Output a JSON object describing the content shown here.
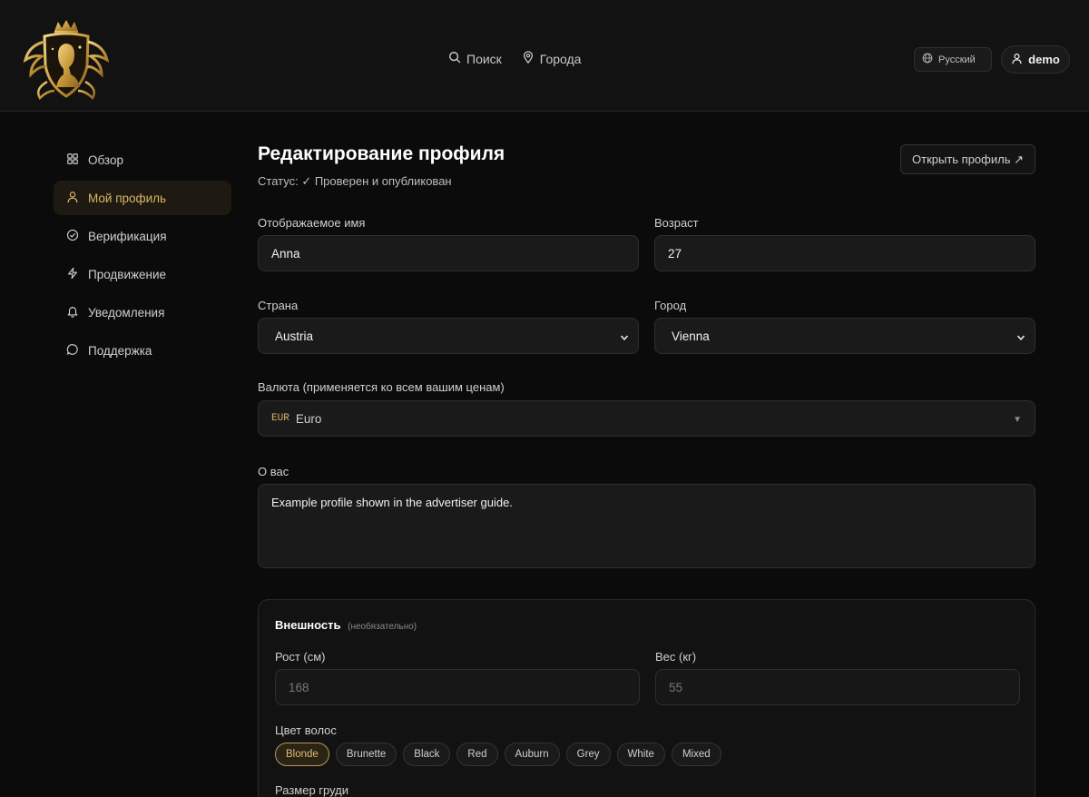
{
  "header": {
    "nav": [
      {
        "label": "Поиск",
        "icon": "search-icon"
      },
      {
        "label": "Города",
        "icon": "map-pin-icon"
      }
    ],
    "language": "Русский",
    "user": "demo",
    "brand_color": "#d9b568"
  },
  "sidebar": {
    "items": [
      {
        "label": "Обзор",
        "icon": "grid-icon",
        "active": false
      },
      {
        "label": "Мой профиль",
        "icon": "user-icon",
        "active": true
      },
      {
        "label": "Верификация",
        "icon": "check-circle-icon",
        "active": false
      },
      {
        "label": "Продвижение",
        "icon": "bolt-icon",
        "active": false
      },
      {
        "label": "Уведомления",
        "icon": "bell-icon",
        "active": false
      },
      {
        "label": "Поддержка",
        "icon": "chat-icon",
        "active": false
      }
    ]
  },
  "main": {
    "title": "Редактирование профиля",
    "status": "Статус: ✓ Проверен и опубликован",
    "open_profile": "Открыть профиль ↗",
    "display_name": {
      "label": "Отображаемое имя",
      "value": "Anna"
    },
    "age": {
      "label": "Возраст",
      "value": "27"
    },
    "country": {
      "label": "Страна",
      "value": "Austria"
    },
    "city": {
      "label": "Город",
      "value": "Vienna"
    },
    "currency": {
      "label": "Валюта (применяется ко всем вашим ценам)",
      "code": "EUR",
      "value": "Euro"
    },
    "about": {
      "label": "О вас",
      "value": "Example profile shown in the advertiser guide."
    },
    "appearance": {
      "title": "Внешность",
      "optional": "(необязательно)",
      "height": {
        "label": "Рост (см)",
        "placeholder": "168"
      },
      "weight": {
        "label": "Вес (кг)",
        "placeholder": "55"
      },
      "hair_label": "Цвет волос",
      "hair_options": [
        "Blonde",
        "Brunette",
        "Black",
        "Red",
        "Auburn",
        "Grey",
        "White",
        "Mixed"
      ],
      "hair_selected": "Blonde",
      "bust_label": "Размер груди"
    }
  }
}
